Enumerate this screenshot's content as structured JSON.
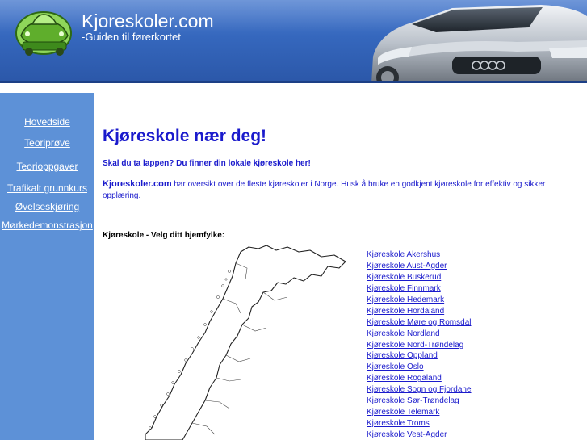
{
  "header": {
    "title": "Kjoreskoler.com",
    "subtitle": "-Guiden til førerkortet"
  },
  "sidebar": {
    "items": [
      {
        "label": "Hovedside"
      },
      {
        "label": "Teoriprøve"
      },
      {
        "label": "Teorioppgaver"
      },
      {
        "label": "Trafikalt grunnkurs"
      },
      {
        "label": "Øvelseskjøring"
      },
      {
        "label": "Mørkedemonstrasjon"
      }
    ]
  },
  "main": {
    "title": "Kjøreskole nær deg!",
    "intro_heading": "Skal du ta lappen? Du finner din lokale kjøreskole her!",
    "intro_brand": "Kjoreskoler.com",
    "intro_text": " har oversikt over de fleste kjøreskoler i Norge. Husk å bruke en godkjent kjøreskole for effektiv og sikker opplæring.",
    "select_heading": "Kjøreskole - Velg ditt hjemfylke:"
  },
  "counties": [
    "Kjøreskole Akershus",
    "Kjøreskole Aust-Agder",
    "Kjøreskole Buskerud",
    "Kjøreskole Finnmark",
    "Kjøreskole Hedemark",
    "Kjøreskole Hordaland",
    "Kjøreskole Møre og Romsdal",
    "Kjøreskole Nordland",
    "Kjøreskole Nord-Trøndelag",
    "Kjøreskole Oppland",
    "Kjøreskole Oslo",
    "Kjøreskole Rogaland",
    "Kjøreskole Sogn og Fjordane",
    "Kjøreskole Sør-Trøndelag",
    "Kjøreskole Telemark",
    "Kjøreskole Troms",
    "Kjøreskole Vest-Agder"
  ],
  "colors": {
    "header_blue": "#3567bd",
    "sidebar_blue": "#5d91d7",
    "link_blue": "#1a1acc"
  }
}
